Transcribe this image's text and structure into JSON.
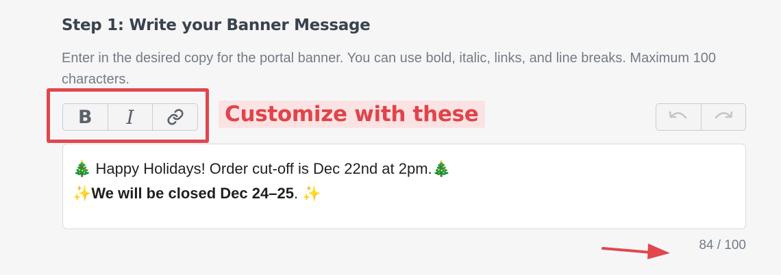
{
  "step": {
    "title": "Step 1: Write your Banner Message",
    "description": "Enter in the desired copy for the portal banner. You can use bold, italic, links, and line breaks. Maximum 100 characters."
  },
  "toolbar": {
    "buttons": [
      {
        "name": "bold-button",
        "label": "B",
        "icon": "bold-icon"
      },
      {
        "name": "italic-button",
        "label": "I",
        "icon": "italic-icon"
      },
      {
        "name": "link-button",
        "icon": "link-icon"
      }
    ],
    "history": [
      {
        "name": "undo-button",
        "icon": "undo-icon",
        "enabled": false
      },
      {
        "name": "redo-button",
        "icon": "redo-icon",
        "enabled": false
      }
    ]
  },
  "annotation": {
    "text": "Customize with these",
    "color": "#e0484d"
  },
  "editor": {
    "line1": "🎄 Happy Holidays! Order cut-off is Dec 22nd at 2pm.🎄",
    "line2_prefix": "✨",
    "line2_bold": "We will be closed Dec 24–25",
    "line2_suffix": ". ✨"
  },
  "counter": {
    "text": "84 / 100",
    "count": 84,
    "max": 100
  }
}
